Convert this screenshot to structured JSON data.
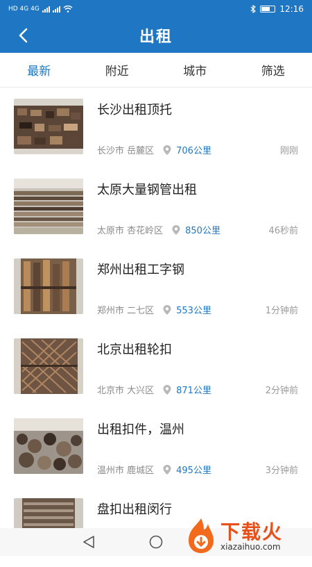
{
  "status": {
    "left": "HD 4G 4G",
    "time": "12:16"
  },
  "header": {
    "title": "出租"
  },
  "tabs": [
    {
      "label": "最新",
      "active": true
    },
    {
      "label": "附近",
      "active": false
    },
    {
      "label": "城市",
      "active": false
    },
    {
      "label": "筛选",
      "active": false
    }
  ],
  "items": [
    {
      "title": "长沙出租顶托",
      "location": "长沙市 岳麓区",
      "distance": "706公里",
      "time": "刚刚"
    },
    {
      "title": "太原大量钢管出租",
      "location": "太原市 杏花岭区",
      "distance": "850公里",
      "time": "46秒前"
    },
    {
      "title": "郑州出租工字钢",
      "location": "郑州市 二七区",
      "distance": "553公里",
      "time": "1分钟前"
    },
    {
      "title": "北京出租轮扣",
      "location": "北京市 大兴区",
      "distance": "871公里",
      "time": "2分钟前"
    },
    {
      "title": "出租扣件，温州",
      "location": "温州市 鹿城区",
      "distance": "495公里",
      "time": "3分钟前"
    },
    {
      "title": "盘扣出租闵行",
      "location": "",
      "distance": "",
      "time": ""
    }
  ],
  "watermark": {
    "brand": "下载火",
    "site": "xiazaihuo.com"
  },
  "colors": {
    "primary": "#1f76c2",
    "accent": "#e8501a"
  }
}
